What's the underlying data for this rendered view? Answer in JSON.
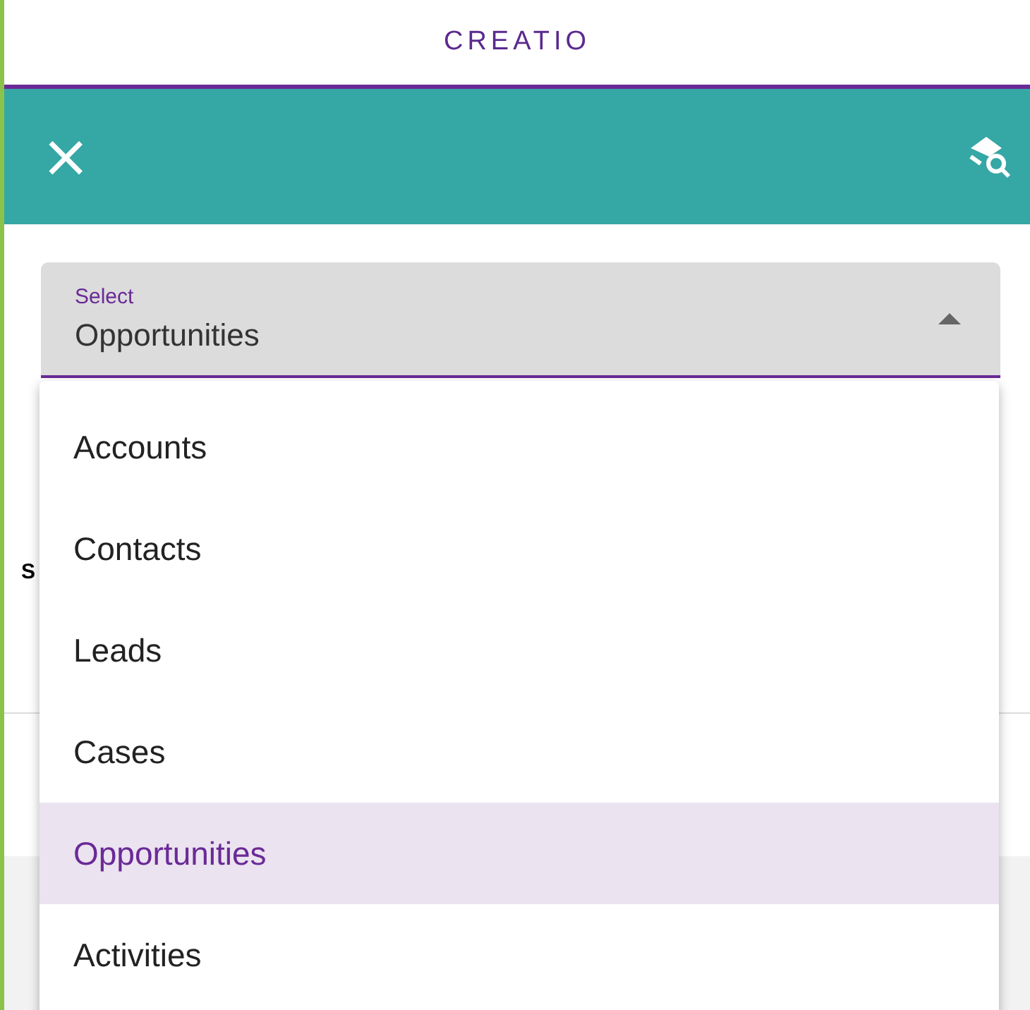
{
  "header": {
    "title": "CREATIO"
  },
  "toolbar": {
    "close": "×"
  },
  "background": {
    "label": "S"
  },
  "select": {
    "label": "Select",
    "value": "Opportunities",
    "expanded": true
  },
  "options": [
    {
      "label": "Accounts",
      "selected": false
    },
    {
      "label": "Contacts",
      "selected": false
    },
    {
      "label": "Leads",
      "selected": false
    },
    {
      "label": "Cases",
      "selected": false
    },
    {
      "label": "Opportunities",
      "selected": true
    },
    {
      "label": "Activities",
      "selected": false
    }
  ]
}
